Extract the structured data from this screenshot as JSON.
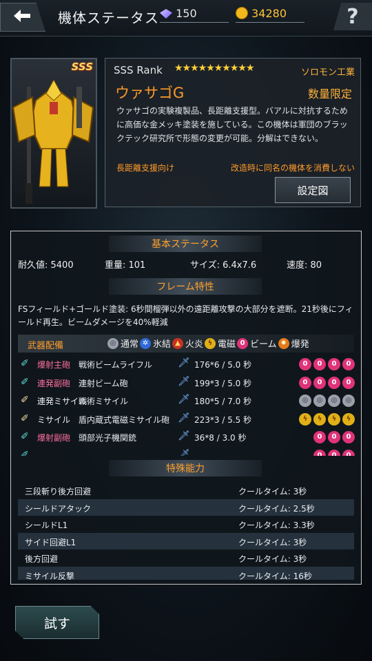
{
  "header": {
    "title": "機体ステータス",
    "gems": "150",
    "coins": "34280"
  },
  "unit": {
    "rank": "SSS Rank",
    "badge": "SSS",
    "stars": "★★★★★★★★★★",
    "maker": "ソロモン工業",
    "name": "ウァサゴG",
    "limited": "数量限定",
    "description": "ウァサゴの実験複製品、長距離支援型。バアルに対抗するために高価な金メッキ塗装を施している。この機体は軍団のブラックテック研究所で形態の変更が可能。分解はできない。",
    "tag_left": "長距離支援向け",
    "tag_right": "改造時に同名の機体を消費しない",
    "design_button": "設定図"
  },
  "basic": {
    "header": "基本ステータス",
    "durability": "耐久値: 5400",
    "weight": "重量: 101",
    "size": "サイズ: 6.4x7.6",
    "speed": "速度: 80"
  },
  "frame": {
    "header": "フレーム特性",
    "text": "FSフィールド+ゴールド塗装: 6秒間榴弾以外の遠距離攻撃の大部分を遮断。21秒後にフィールド再生。ビームダメージを40%軽減"
  },
  "weapons": {
    "header": "武器配備",
    "legend": [
      {
        "label": "通常",
        "icon": "normal"
      },
      {
        "label": "氷結",
        "icon": "freeze"
      },
      {
        "label": "火炎",
        "icon": "fire"
      },
      {
        "label": "電磁",
        "icon": "elec"
      },
      {
        "label": "ビーム",
        "icon": "beam"
      },
      {
        "label": "爆発",
        "icon": "blast"
      }
    ],
    "rows": [
      {
        "type": "爆射主砲",
        "name": "戦術ビームライフル",
        "dmg": "176*6 / 5.0 秒",
        "color": "red",
        "attr": [
          "beam",
          "beam",
          "beam",
          "beam"
        ]
      },
      {
        "type": "連発副砲",
        "name": "連射ビーム砲",
        "dmg": "199*3 / 5.0 秒",
        "color": "red",
        "attr": [
          "beam",
          "beam",
          "beam",
          "beam"
        ]
      },
      {
        "type": "連発ミサイル",
        "name": "戦術ミサイル",
        "dmg": "180*5 / 7.0 秒",
        "color": "white",
        "attr": [
          "normal",
          "normal",
          "normal",
          "normal"
        ]
      },
      {
        "type": "ミサイル",
        "name": "盾内蔵式電磁ミサイル砲",
        "dmg": "223*3 / 5.5 秒",
        "color": "white",
        "attr": [
          "elec",
          "elec",
          "elec",
          "elec"
        ]
      },
      {
        "type": "爆射副砲",
        "name": "頭部光子機関銃",
        "dmg": "36*8 / 3.0 秒",
        "color": "red",
        "attr": [
          "beam",
          "beam",
          "beam"
        ]
      },
      {
        "type": "",
        "name": "",
        "dmg": "",
        "color": "red",
        "attr": [
          "beam",
          "beam",
          "beam"
        ]
      }
    ]
  },
  "special": {
    "header": "特殊能力",
    "rows": [
      {
        "name": "三段斬り後方回避",
        "cool": "クールタイム: 3秒"
      },
      {
        "name": "シールドアタック",
        "cool": "クールタイム: 2.5秒"
      },
      {
        "name": "シールドL1",
        "cool": "クールタイム: 3.3秒"
      },
      {
        "name": "サイド回避L1",
        "cool": "クールタイム: 3秒"
      },
      {
        "name": "後方回避",
        "cool": "クールタイム: 3秒"
      },
      {
        "name": "ミサイル反撃",
        "cool": "クールタイム: 16秒"
      }
    ]
  },
  "footer": {
    "try_button": "試す"
  }
}
